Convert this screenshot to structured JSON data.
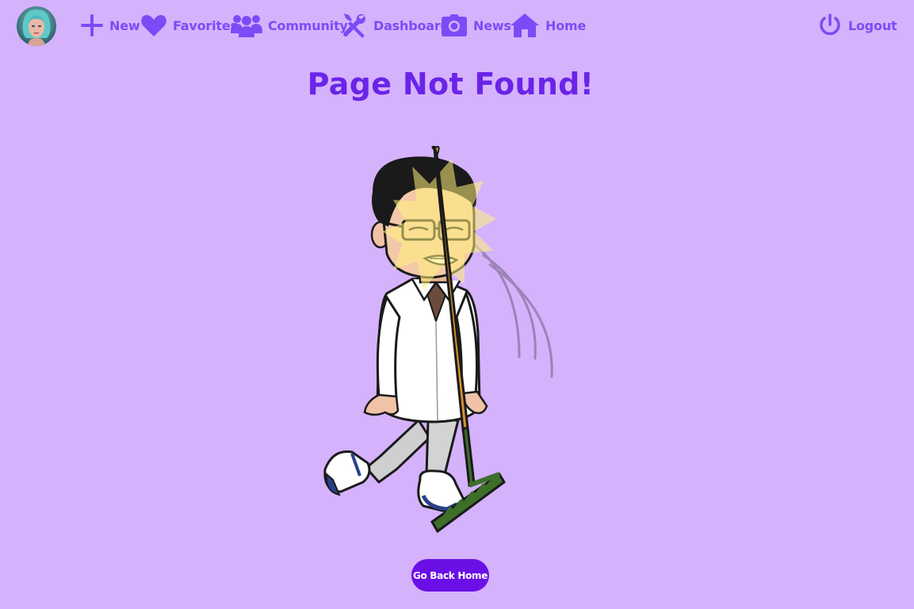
{
  "nav": {
    "items": [
      {
        "label": "New",
        "icon": "plus-icon"
      },
      {
        "label": "Favorites",
        "icon": "heart-icon"
      },
      {
        "label": "Community",
        "icon": "users-icon"
      },
      {
        "label": "Dashboard",
        "icon": "tools-icon"
      },
      {
        "label": "News",
        "icon": "camera-icon"
      },
      {
        "label": "Home",
        "icon": "home-icon"
      }
    ],
    "logout": {
      "label": "Logout",
      "icon": "power-icon"
    }
  },
  "page": {
    "title": "Page Not Found!",
    "home_button_label": "Go Back Home"
  },
  "colors": {
    "background": "#d5b2fc",
    "accent": "#7b4cf6",
    "title": "#6a24e8",
    "button": "#6a10e6"
  }
}
